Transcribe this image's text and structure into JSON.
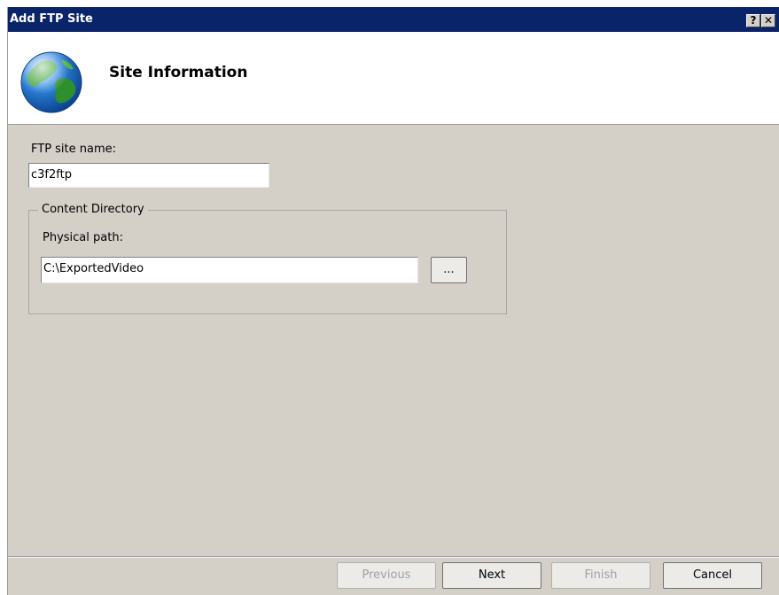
{
  "window": {
    "title": "Add FTP Site",
    "help_button": "?",
    "close_button": "✕"
  },
  "banner": {
    "title": "Site Information",
    "icon": "globe-icon"
  },
  "form": {
    "site_name_label": "FTP site name:",
    "site_name_value": "c3f2ftp",
    "content_directory": {
      "legend": "Content Directory",
      "physical_path_label": "Physical path:",
      "physical_path_value": "C:\\ExportedVideo",
      "browse_label": "..."
    }
  },
  "footer": {
    "buttons": [
      {
        "label": "Previous",
        "enabled": false
      },
      {
        "label": "Next",
        "enabled": true
      },
      {
        "label": "Finish",
        "enabled": false
      },
      {
        "label": "Cancel",
        "enabled": true
      }
    ]
  },
  "colors": {
    "titlebar": "#0a246a",
    "dialog_background": "#d4d0c8",
    "banner_background": "#ffffff",
    "disabled_text": "#a0a0a0"
  }
}
